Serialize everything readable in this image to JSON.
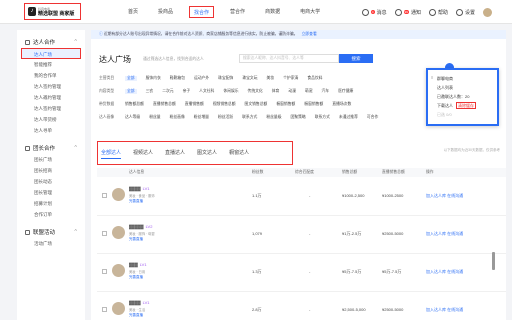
{
  "logo": {
    "small_text": "抖音电商",
    "main_text": "精选联盟 商家版"
  },
  "nav": [
    "首页",
    "投商品",
    "找合作",
    "营合作",
    "商数据",
    "电商大学"
  ],
  "nav_active_index": 2,
  "topbar": {
    "message": "消息",
    "message_badge": "4",
    "notice": "通知",
    "notice_badge": "99",
    "help": "帮助",
    "settings": "设置"
  },
  "sidebar": {
    "sections": [
      {
        "label": "达人合作",
        "items": [
          "达人广场",
          "智能推荐",
          "我的合作单",
          "达人签约管理",
          "达人邀约管理",
          "达人签约管理",
          "达人带货榜",
          "达人寻单"
        ]
      },
      {
        "label": "团长合作",
        "items": [
          "团长广场",
          "团长招商",
          "团长动态",
          "团长管理",
          "招募计划",
          "合作订单"
        ]
      },
      {
        "label": "联盟活动",
        "items": [
          "活动广场"
        ]
      }
    ],
    "active": "达人广场"
  },
  "notice": {
    "text": "近期有部分达人账号出现异常情况，请在合作前对达人资质、商家店铺服务等信息进行核实，防止被骗，谨防诈骗。",
    "link": "立即查看"
  },
  "page": {
    "title": "达人广场",
    "subtitle": "通过筛选达人信息，找到合适的达人",
    "search_placeholder": "搜索达人昵称、达人抖音号、达人等",
    "search_button": "搜索"
  },
  "filters": [
    {
      "label": "主营类目",
      "options": [
        "全部",
        "服饰内衣",
        "鞋靴箱包",
        "运动户外",
        "珠宝配饰",
        "珠宝文玩",
        "美妆",
        "个护家清",
        "食品饮料"
      ],
      "selected": 0
    },
    {
      "label": "内容类型",
      "options": [
        "全部",
        "三农",
        "二次元",
        "亲子",
        "人文社科",
        "休闲娱乐",
        "传统文化",
        "体育",
        "动漫",
        "萌宠",
        "汽车",
        "医疗健康"
      ],
      "selected": 0
    },
    {
      "label": "带货数据",
      "options": [
        "销售额总额",
        "直播销售总额",
        "直播销售额",
        "视频销售总额",
        "图文销售总额",
        "橱窗销售额",
        "橱窗销售额",
        "直播场次数"
      ],
      "selected": -1
    },
    {
      "label": "达人画像",
      "options": [
        "达人等级",
        "粉丝量",
        "粉丝画像",
        "粉丝增量",
        "粉丝活跃",
        "联系方式",
        "粉丝量级",
        "团聚策略",
        "联系方式",
        "未通过推荐",
        "可合作"
      ],
      "selected": -1
    }
  ],
  "tabs": [
    "全部达人",
    "视频达人",
    "直播达人",
    "图文达人",
    "橱窗达人"
  ],
  "tabs_active": 0,
  "list_hint": "以下数据均为近30天数据，仅供参考",
  "table": {
    "headers": [
      "达人信息",
      "粉丝数",
      "综合匹配度",
      "销售总额",
      "直播销售总额",
      "操作"
    ],
    "rows": [
      {
        "name": "▓▓▓▓",
        "level": "LV1",
        "tags": "美妆 · 食品 · 服饰",
        "link": "完善直播",
        "fans": "1.1万",
        "match": "-",
        "sales": "¥1000-2,500",
        "live_sales": "¥1000-2500"
      },
      {
        "name": "▓▓▓▓▓",
        "level": "LV2",
        "tags": "美妆 · 服饰 · 母婴",
        "link": "完善直播",
        "fans": "1,079",
        "match": "-",
        "sales": "¥1万-2.5万",
        "live_sales": "¥2500-5000"
      },
      {
        "name": "▓▓▓",
        "level": "LV1",
        "tags": "美妆 · 日用",
        "link": "完善直播",
        "fans": "1.3万",
        "match": "-",
        "sales": "¥5万-7.5万",
        "live_sales": "¥5万-7.5万"
      },
      {
        "name": "▓▓▓▓",
        "level": "LV1",
        "tags": "美妆 · 生活",
        "link": "完善直播",
        "fans": "2.8万",
        "match": "-",
        "sales": "¥2,500-5,000",
        "live_sales": "¥2500-5000"
      }
    ],
    "ops": [
      "加入达人库",
      "在线沟通"
    ]
  },
  "popup": {
    "title": "群聊电商",
    "items": [
      "达人列表",
      "已邀联达人数：20",
      "下载达人"
    ],
    "clear": "清除缓存",
    "footer": "已选 0/0"
  }
}
